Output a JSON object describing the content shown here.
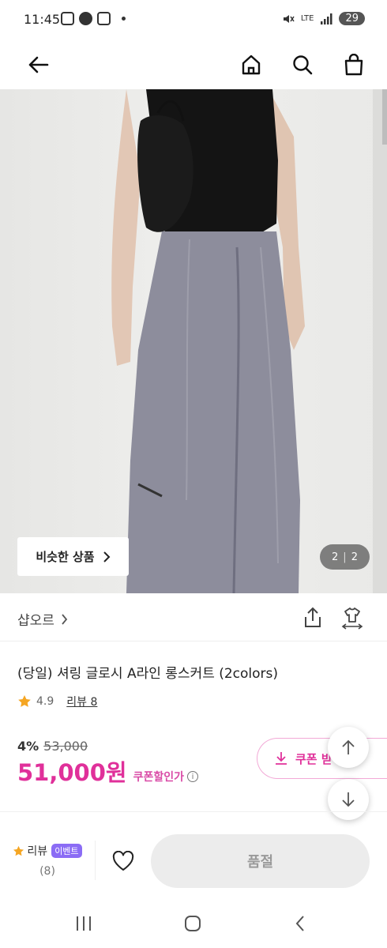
{
  "status_bar": {
    "time": "11:45",
    "network": "LTE",
    "battery": "29"
  },
  "nav": {
    "back_icon": "arrow-left-icon",
    "home_icon": "home-icon",
    "search_icon": "search-icon",
    "cart_icon": "shopping-bag-icon"
  },
  "gallery": {
    "similar_label": "비슷한 상품",
    "current": "2",
    "total": "2"
  },
  "store": {
    "name": "샵오르"
  },
  "product": {
    "title": "(당일) 셔링 글로시 A라인 롱스커트 (2colors)",
    "rating": "4.9",
    "review_label": "리뷰 8",
    "discount": "4%",
    "original_price": "53,000",
    "sale_price": "51,000원",
    "coupon_note": "쿠폰할인가",
    "coupon_button": "쿠폰 받"
  },
  "action_bar": {
    "review_label": "리뷰",
    "event_badge": "이벤트",
    "review_count": "(8)",
    "soldout_label": "품절"
  },
  "colors": {
    "accent": "#e0309a",
    "badge": "#8b6cf5",
    "star": "#f5a623"
  }
}
